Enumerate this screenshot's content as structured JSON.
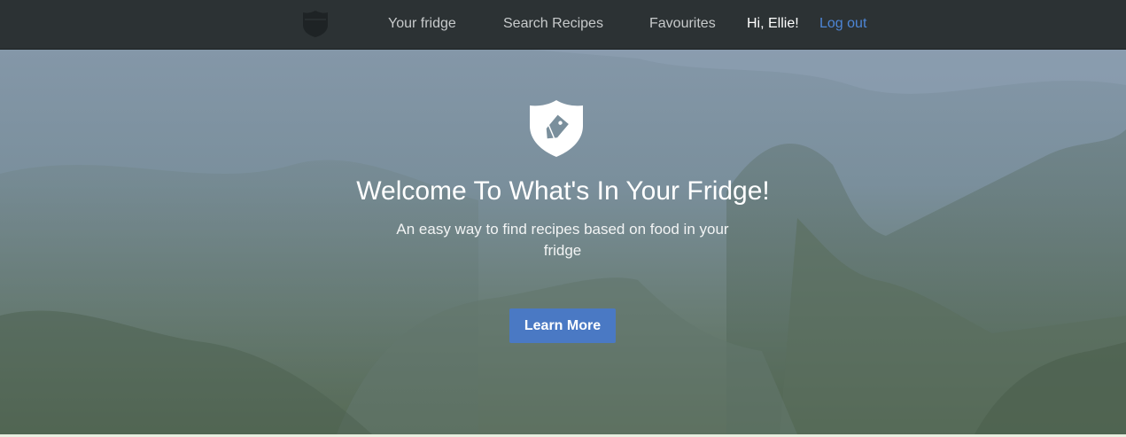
{
  "nav": {
    "logo_icon": "shield-icon",
    "links": [
      {
        "label": "Your fridge"
      },
      {
        "label": "Search Recipes"
      },
      {
        "label": "Favourites"
      }
    ],
    "greeting": "Hi, Ellie!",
    "logout_label": "Log out"
  },
  "hero": {
    "icon": "tag-shield-icon",
    "title": "Welcome To What's In Your Fridge!",
    "subtitle": "An easy way to find recipes based on food in your fridge",
    "button_label": "Learn More"
  },
  "colors": {
    "nav_background": "#2c3234",
    "accent": "#4a79c4",
    "link_active": "#4d86d6"
  }
}
